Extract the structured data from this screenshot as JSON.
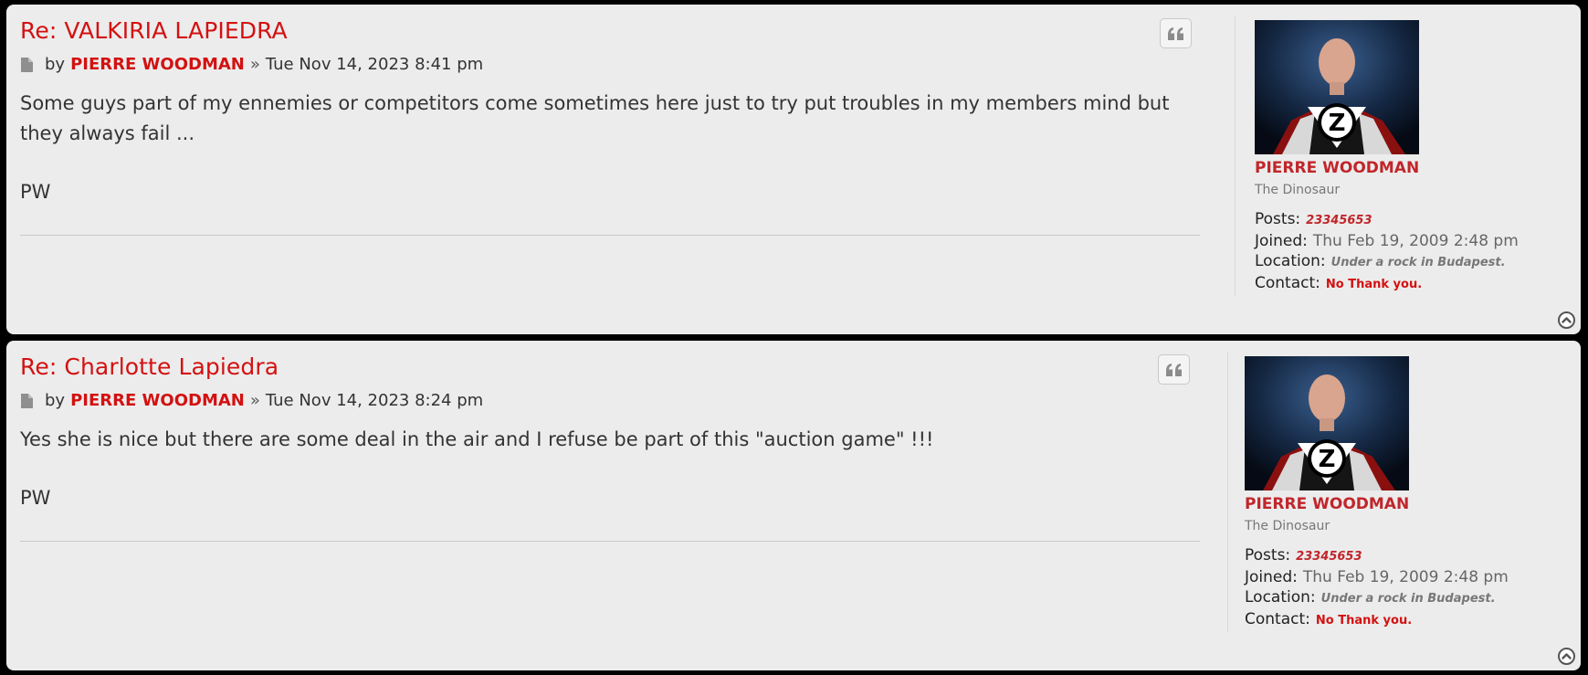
{
  "posts": [
    {
      "title": "Re: VALKIRIA LAPIEDRA",
      "meta": {
        "by": "by",
        "author": "PIERRE WOODMAN",
        "separator": "»",
        "date": "Tue Nov 14, 2023 8:41 pm"
      },
      "content": "Some guys part of my ennemies or competitors come sometimes here just to try put troubles in my members mind but they always fail ...",
      "signature": "PW",
      "profile": {
        "username": "PIERRE WOODMAN",
        "rank": "The Dinosaur",
        "posts_label": "Posts:",
        "posts_value": "23345653",
        "joined_label": "Joined:",
        "joined_value": "Thu Feb 19, 2009 2:48 pm",
        "location_label": "Location:",
        "location_value": "Under a rock in Budapest.",
        "contact_label": "Contact:",
        "contact_value": "No Thank you."
      }
    },
    {
      "title": "Re: Charlotte Lapiedra",
      "meta": {
        "by": "by",
        "author": "PIERRE WOODMAN",
        "separator": "»",
        "date": "Tue Nov 14, 2023 8:24 pm"
      },
      "content": "Yes she is nice but there are some deal in the air and I refuse be part of this \"auction game\" !!!",
      "signature": "PW",
      "profile": {
        "username": "PIERRE WOODMAN",
        "rank": "The Dinosaur",
        "posts_label": "Posts:",
        "posts_value": "23345653",
        "joined_label": "Joined:",
        "joined_value": "Thu Feb 19, 2009 2:48 pm",
        "location_label": "Location:",
        "location_value": "Under a rock in Budapest.",
        "contact_label": "Contact:",
        "contact_value": "No Thank you."
      }
    }
  ],
  "icons": {
    "post": "file-icon",
    "quote": "quote-icon",
    "back_to_top": "chevron-up-circle-icon",
    "avatar_emblem": "Z"
  },
  "colors": {
    "accent_red": "#d31111",
    "username_red": "#c0262b",
    "post_bg": "#ececec",
    "page_bg": "#000000"
  }
}
